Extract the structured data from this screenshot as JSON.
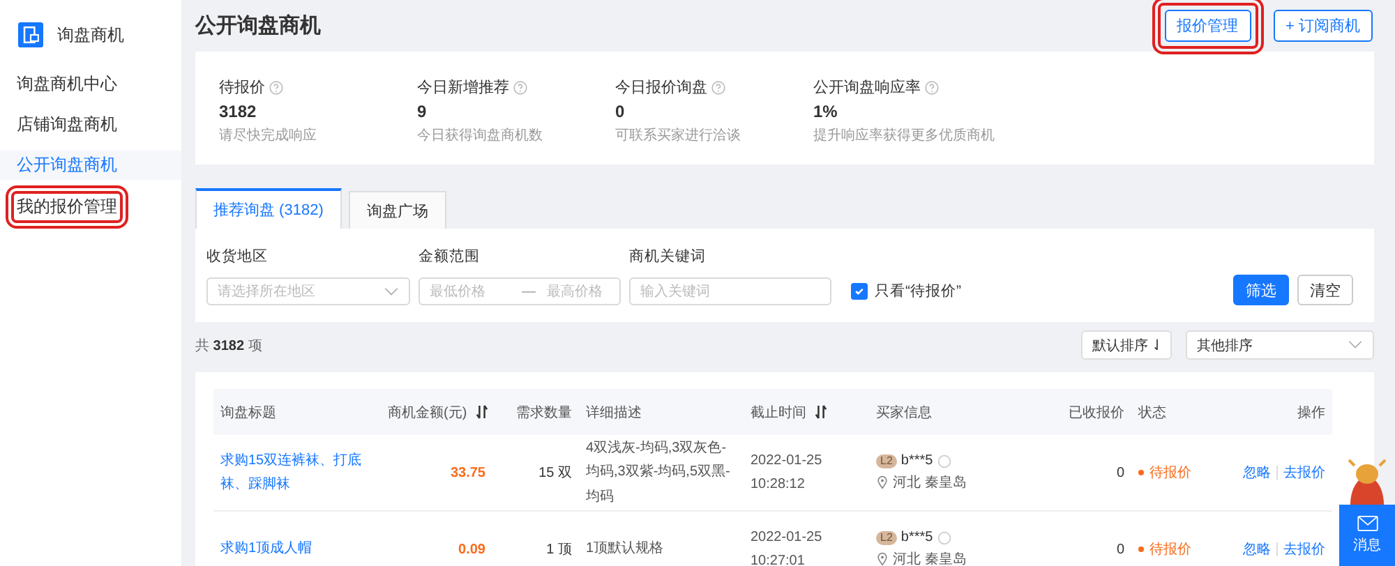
{
  "sidebar": {
    "title": "询盘商机",
    "items": [
      {
        "label": "询盘商机中心",
        "selected": false,
        "highlighted": false
      },
      {
        "label": "店铺询盘商机",
        "selected": false,
        "highlighted": false
      },
      {
        "label": "公开询盘商机",
        "selected": true,
        "highlighted": false
      },
      {
        "label": "我的报价管理",
        "selected": false,
        "highlighted": true
      }
    ]
  },
  "header": {
    "title": "公开询盘商机",
    "buttons": [
      {
        "label": "报价管理",
        "highlighted": true
      },
      {
        "label": "+ 订阅商机",
        "highlighted": false
      }
    ]
  },
  "stats": [
    {
      "label": "待报价",
      "value": "3182",
      "hint": "请尽快完成响应"
    },
    {
      "label": "今日新增推荐",
      "value": "9",
      "hint": "今日获得询盘商机数"
    },
    {
      "label": "今日报价询盘",
      "value": "0",
      "hint": "可联系买家进行洽谈"
    },
    {
      "label": "公开询盘响应率",
      "value": "1%",
      "hint": "提升响应率获得更多优质商机"
    }
  ],
  "tabs": [
    {
      "label": "推荐询盘 (3182)",
      "selected": true
    },
    {
      "label": "询盘广场",
      "selected": false
    }
  ],
  "filters": {
    "region": {
      "label": "收货地区",
      "placeholder": "请选择所在地区"
    },
    "amount": {
      "label": "金额范围",
      "min_placeholder": "最低价格",
      "separator": "—",
      "max_placeholder": "最高价格"
    },
    "keyword": {
      "label": "商机关键词",
      "placeholder": "输入关键词"
    },
    "only_pending": {
      "label": "只看“待报价”",
      "checked": true
    },
    "buttons": [
      "筛选",
      "清空"
    ]
  },
  "summary": {
    "prefix": "共",
    "count": "3182",
    "suffix": "项"
  },
  "sort": {
    "default": "默认排序",
    "other": "其他排序"
  },
  "table": {
    "columns": [
      {
        "label": "询盘标题",
        "sortable": false
      },
      {
        "label": "商机金额(元)",
        "sortable": true
      },
      {
        "label": "需求数量",
        "sortable": false
      },
      {
        "label": "详细描述",
        "sortable": false
      },
      {
        "label": "截止时间",
        "sortable": true
      },
      {
        "label": "买家信息",
        "sortable": false
      },
      {
        "label": "已收报价",
        "sortable": false
      },
      {
        "label": "状态",
        "sortable": false
      },
      {
        "label": "操作",
        "sortable": false
      }
    ],
    "rows": [
      {
        "title": "求购15双连裤袜、打底袜、踩脚袜",
        "amount": "33.75",
        "quantity": "15 双",
        "description": "4双浅灰-均码,3双灰色-均码,3双紫-均码,5双黑-均码",
        "deadline": [
          "2022-01-25",
          "10:28:12"
        ],
        "buyer": {
          "level": "L2",
          "name": "b***5",
          "location": "河北 秦皇岛"
        },
        "quotes": "0",
        "status": {
          "label": "待报价",
          "color": "#fa6b1b"
        },
        "actions": [
          "忽略",
          "去报价"
        ]
      },
      {
        "title": "求购1顶成人帽",
        "amount": "0.09",
        "quantity": "1 顶",
        "description": "1顶默认规格",
        "deadline": [
          "2022-01-25",
          "10:27:01"
        ],
        "buyer": {
          "level": "L2",
          "name": "b***5",
          "location": "河北 秦皇岛"
        },
        "quotes": "0",
        "status": {
          "label": "待报价",
          "color": "#fa6b1b"
        },
        "actions": [
          "忽略",
          "去报价"
        ]
      }
    ]
  },
  "message_widget": {
    "label": "消息"
  }
}
